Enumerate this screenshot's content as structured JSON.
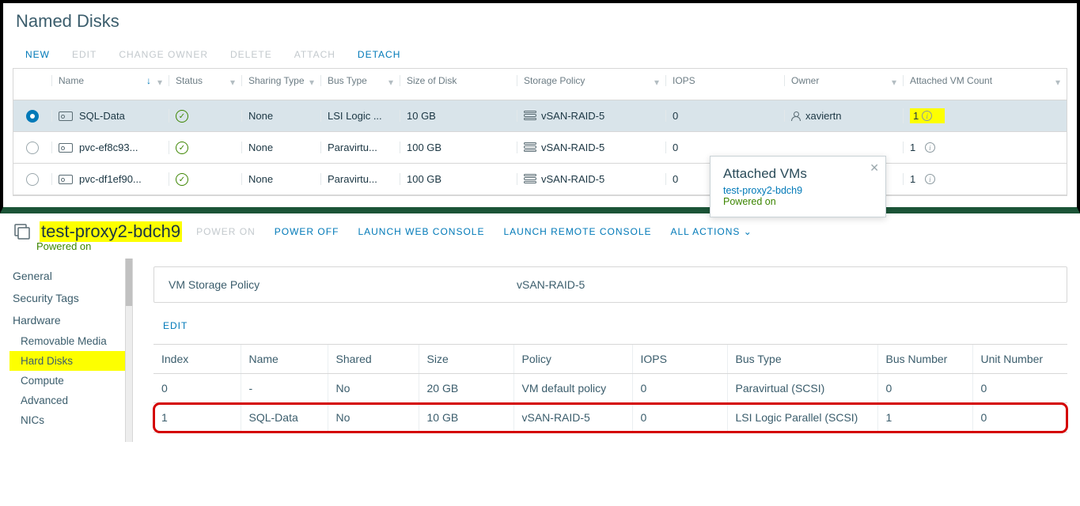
{
  "top": {
    "title": "Named Disks",
    "actions": {
      "new": "NEW",
      "edit": "EDIT",
      "change_owner": "CHANGE OWNER",
      "delete": "DELETE",
      "attach": "ATTACH",
      "detach": "DETACH"
    }
  },
  "columns": {
    "name": "Name",
    "status": "Status",
    "sharing": "Sharing Type",
    "bus": "Bus Type",
    "size": "Size of Disk",
    "policy": "Storage Policy",
    "iops": "IOPS",
    "owner": "Owner",
    "attached": "Attached VM Count"
  },
  "rows": [
    {
      "name": "SQL-Data",
      "sharing": "None",
      "bus": "LSI Logic ...",
      "size": "10 GB",
      "policy": "vSAN-RAID-5",
      "iops": "0",
      "owner": "xaviertn",
      "attached": "1"
    },
    {
      "name": "pvc-ef8c93...",
      "sharing": "None",
      "bus": "Paravirtu...",
      "size": "100 GB",
      "policy": "vSAN-RAID-5",
      "iops": "0",
      "owner": "",
      "attached": "1"
    },
    {
      "name": "pvc-df1ef90...",
      "sharing": "None",
      "bus": "Paravirtu...",
      "size": "100 GB",
      "policy": "vSAN-RAID-5",
      "iops": "0",
      "owner": "",
      "attached": "1"
    }
  ],
  "popover": {
    "title": "Attached VMs",
    "link": "test-proxy2-bdch9",
    "state": "Powered on"
  },
  "vm": {
    "name": "test-proxy2-bdch9",
    "state": "Powered on",
    "actions": {
      "power_on": "POWER ON",
      "power_off": "POWER OFF",
      "launch_web": "LAUNCH WEB CONSOLE",
      "launch_remote": "LAUNCH REMOTE CONSOLE",
      "all_actions": "ALL ACTIONS"
    }
  },
  "sidebar": {
    "general": "General",
    "security": "Security Tags",
    "hardware": "Hardware",
    "removable": "Removable Media",
    "hard_disks": "Hard Disks",
    "compute": "Compute",
    "advanced": "Advanced",
    "nics": "NICs"
  },
  "policy_box": {
    "label": "VM Storage Policy",
    "value": "vSAN-RAID-5"
  },
  "edit_label": "EDIT",
  "hd_columns": {
    "index": "Index",
    "name": "Name",
    "shared": "Shared",
    "size": "Size",
    "policy": "Policy",
    "iops": "IOPS",
    "bus": "Bus Type",
    "busnum": "Bus Number",
    "unit": "Unit Number"
  },
  "hd_rows": [
    {
      "index": "0",
      "name": "-",
      "shared": "No",
      "size": "20 GB",
      "policy": "VM default policy",
      "iops": "0",
      "bus": "Paravirtual (SCSI)",
      "busnum": "0",
      "unit": "0"
    },
    {
      "index": "1",
      "name": "SQL-Data",
      "shared": "No",
      "size": "10 GB",
      "policy": "vSAN-RAID-5",
      "iops": "0",
      "bus": "LSI Logic Parallel (SCSI)",
      "busnum": "1",
      "unit": "0"
    }
  ]
}
